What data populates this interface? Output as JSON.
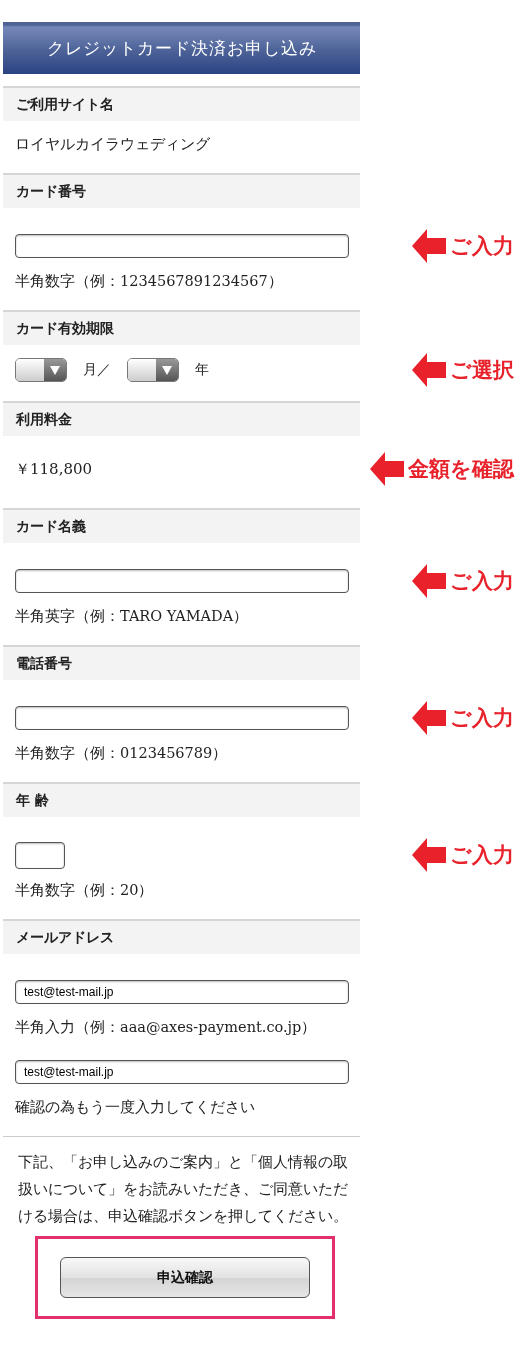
{
  "title": "クレジットカード決済お申し込み",
  "sections": [
    {
      "label": "ご利用サイト名",
      "items": [
        {
          "kind": "text",
          "text": "ロイヤルカイラウェディング"
        }
      ]
    },
    {
      "label": "カード番号",
      "items": [
        {
          "kind": "input",
          "value": "",
          "callout": "ご入力"
        },
        {
          "kind": "hint",
          "text": "半角数字（例：1234567891234567）"
        }
      ]
    },
    {
      "label": "カード有効期限",
      "items": [
        {
          "kind": "date_select",
          "month_label": "月／",
          "year_label": "年",
          "callout": "ご選択"
        }
      ]
    },
    {
      "label": "利用料金",
      "items": [
        {
          "kind": "amount",
          "text": "￥118,800",
          "callout": "金額を確認"
        }
      ]
    },
    {
      "label": "カード名義",
      "items": [
        {
          "kind": "input",
          "value": "",
          "callout": "ご入力"
        },
        {
          "kind": "hint",
          "text": "半角英字（例：TARO YAMADA）"
        }
      ]
    },
    {
      "label": "電話番号",
      "items": [
        {
          "kind": "input",
          "value": "",
          "callout": "ご入力"
        },
        {
          "kind": "hint",
          "text": "半角数字（例：0123456789）"
        }
      ]
    },
    {
      "label": "年 齢",
      "items": [
        {
          "kind": "short_input",
          "value": "",
          "callout": "ご入力"
        },
        {
          "kind": "hint",
          "text": "半角数字（例：20）"
        }
      ]
    },
    {
      "label": "メールアドレス",
      "items": [
        {
          "kind": "input",
          "value": "test@test-mail.jp"
        },
        {
          "kind": "hint",
          "text": "半角入力（例：aaa@axes-payment.co.jp）"
        },
        {
          "kind": "input",
          "value": "test@test-mail.jp"
        },
        {
          "kind": "hint",
          "text": "確認の為もう一度入力してください"
        }
      ]
    }
  ],
  "notice": "下記、「お申し込みのご案内」と「個人情報の取扱いについて」をお読みいただき、ご同意いただける場合は、申込確認ボタンを押してください。",
  "submit_button": {
    "label": "申込確認",
    "highlighted": true
  }
}
